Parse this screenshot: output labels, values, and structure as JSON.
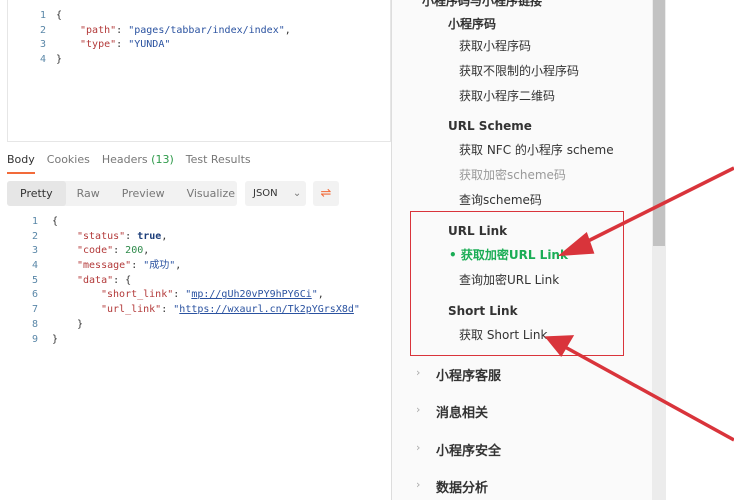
{
  "request_body": {
    "lines": [
      {
        "n": "1",
        "html": "{"
      },
      {
        "n": "2",
        "key": "path",
        "val": "pages/tabbar/index/index"
      },
      {
        "n": "3",
        "key": "type",
        "val": "YUNDA"
      },
      {
        "n": "4",
        "html": "}"
      }
    ]
  },
  "response_tabs": {
    "body": "Body",
    "cookies": "Cookies",
    "headers": "Headers",
    "headers_count": "(13)",
    "tests": "Test Results"
  },
  "view_modes": {
    "pretty": "Pretty",
    "raw": "Raw",
    "preview": "Preview",
    "visualize": "Visualize"
  },
  "format": {
    "selected": "JSON",
    "wrap_icon": "wrap-lines-icon"
  },
  "response": {
    "line_numbers": [
      "1",
      "2",
      "3",
      "4",
      "5",
      "6",
      "7",
      "8",
      "9"
    ],
    "status_key": "\"status\"",
    "status_val": "true",
    "code_key": "\"code\"",
    "code_val": "200",
    "message_key": "\"message\"",
    "message_val": "\"成功\"",
    "data_key": "\"data\"",
    "short_key": "\"short_link\"",
    "short_val": "mp://gUh20vPY9hPY6Ci",
    "url_key": "\"url_link\"",
    "url_val": "https://wxaurl.cn/Tk2pYGrsX8d"
  },
  "sidebar": {
    "top_heading": "小程序码与小程序链接",
    "groups": [
      {
        "title": "小程序码",
        "items": [
          "获取小程序码",
          "获取不限制的小程序码",
          "获取小程序二维码"
        ]
      },
      {
        "title": "URL Scheme",
        "items": [
          "获取 NFC 的小程序 scheme",
          "获取加密scheme码",
          "查询scheme码"
        ]
      },
      {
        "title": "URL Link",
        "items": [
          "获取加密URL Link",
          "查询加密URL Link"
        ]
      },
      {
        "title": "Short Link",
        "items": [
          "获取 Short Link"
        ]
      }
    ],
    "nav": [
      "小程序客服",
      "消息相关",
      "小程序安全",
      "数据分析"
    ]
  },
  "colors": {
    "accent": "#f26b3a",
    "active": "#1aad55",
    "annotation": "#d9343b"
  }
}
